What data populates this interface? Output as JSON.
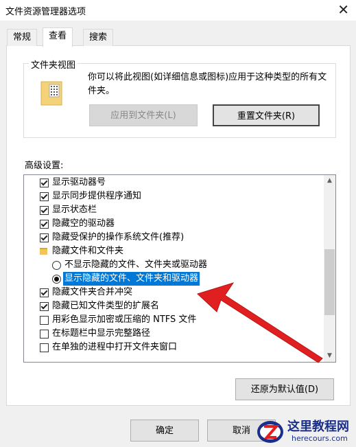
{
  "window": {
    "title": "文件资源管理器选项",
    "close_glyph": "✕"
  },
  "tabs": [
    {
      "label": "常规",
      "active": false
    },
    {
      "label": "查看",
      "active": true
    },
    {
      "label": "搜索",
      "active": false
    }
  ],
  "folder_view": {
    "group_label": "文件夹视图",
    "description": "你可以将此视图(如详细信息或图标)应用于这种类型的所有文件夹。",
    "apply_button": "应用到文件夹(L)",
    "reset_button": "重置文件夹(R)"
  },
  "advanced": {
    "label": "高级设置:",
    "items": [
      {
        "type": "checkbox",
        "checked": true,
        "label": "显示驱动器号"
      },
      {
        "type": "checkbox",
        "checked": true,
        "label": "显示同步提供程序通知"
      },
      {
        "type": "checkbox",
        "checked": true,
        "label": "显示状态栏"
      },
      {
        "type": "checkbox",
        "checked": true,
        "label": "隐藏空的驱动器"
      },
      {
        "type": "checkbox",
        "checked": true,
        "label": "隐藏受保护的操作系统文件(推荐)"
      },
      {
        "type": "folder",
        "label": "隐藏文件和文件夹"
      },
      {
        "type": "radio",
        "checked": false,
        "label": "不显示隐藏的文件、文件夹或驱动器"
      },
      {
        "type": "radio",
        "checked": true,
        "selected": true,
        "label": "显示隐藏的文件、文件夹和驱动器"
      },
      {
        "type": "checkbox",
        "checked": true,
        "label": "隐藏文件夹合并冲突"
      },
      {
        "type": "checkbox",
        "checked": true,
        "label": "隐藏已知文件类型的扩展名"
      },
      {
        "type": "checkbox",
        "checked": false,
        "label": "用彩色显示加密或压缩的 NTFS 文件"
      },
      {
        "type": "checkbox",
        "checked": false,
        "label": "在标题栏中显示完整路径"
      },
      {
        "type": "checkbox",
        "checked": false,
        "label": "在单独的进程中打开文件夹窗口"
      }
    ],
    "restore_button": "还原为默认值(D)"
  },
  "footer": {
    "ok_button": "确定",
    "cancel_button": "取消"
  },
  "watermark": {
    "title": "这里教程网",
    "url": "herecours.com"
  },
  "colors": {
    "selection": "#0078d7",
    "arrow": "#e02020"
  }
}
